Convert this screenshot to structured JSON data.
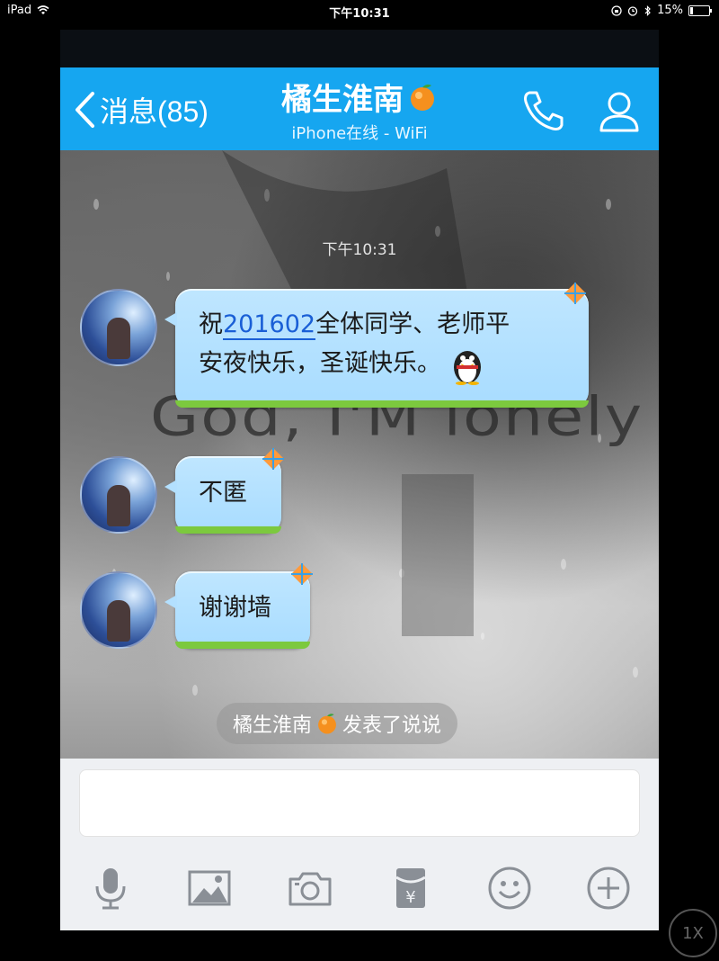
{
  "status_bar": {
    "device": "iPad",
    "time": "下午10:31",
    "battery": "15%",
    "battery_level": 0.15
  },
  "nav": {
    "back_label": "消息(85)",
    "title": "橘生淮南",
    "subtitle": "iPhone在线 - WiFi"
  },
  "chat": {
    "timestamp": "下午10:31",
    "wallpaper_text": "God, I'M lonely",
    "messages": [
      {
        "line1_prefix": "祝",
        "link": "201602",
        "line1_suffix": "全体同学、老师平",
        "line2": "安夜快乐，圣诞快乐。"
      },
      {
        "text": "不匿"
      },
      {
        "text": "谢谢墙"
      }
    ],
    "notice_name": "橘生淮南",
    "notice_action": "发表了说说"
  },
  "input": {
    "placeholder": ""
  },
  "toolbar": {
    "icons": [
      "microphone-icon",
      "image-icon",
      "camera-icon",
      "red-packet-icon",
      "emoji-icon",
      "plus-icon"
    ],
    "red_packet_symbol": "¥"
  },
  "zoom": {
    "label": "1X"
  },
  "colors": {
    "nav_blue": "#16a6f0",
    "bubble": "#b3e0ff",
    "bubble_grass": "#7cc93e"
  }
}
